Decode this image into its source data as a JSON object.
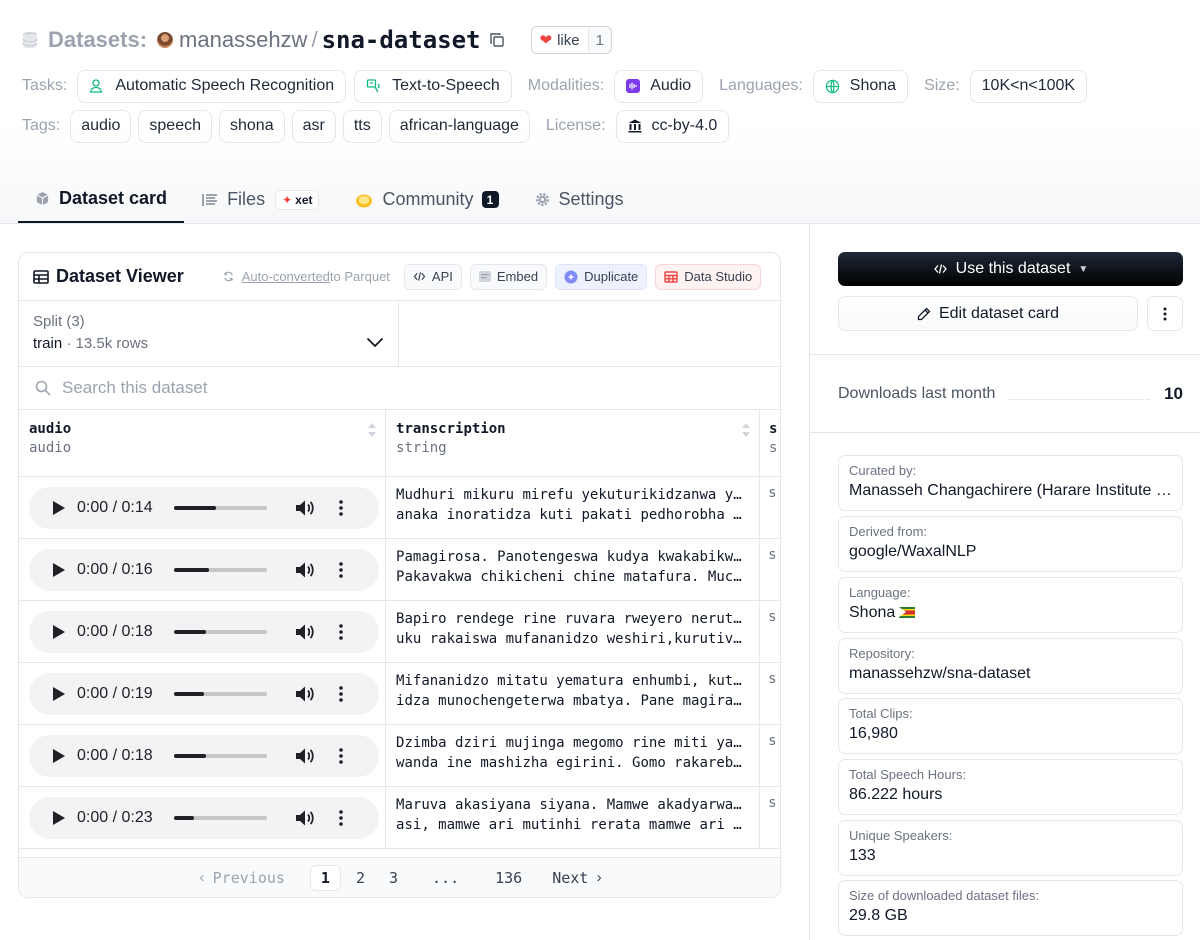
{
  "header": {
    "section": "Datasets:",
    "owner": "manassehzw",
    "separator": "/",
    "repo": "sna-dataset",
    "like_label": "like",
    "like_count": "1"
  },
  "meta": {
    "tasks_label": "Tasks:",
    "tasks": [
      "Automatic Speech Recognition",
      "Text-to-Speech"
    ],
    "modalities_label": "Modalities:",
    "modality": "Audio",
    "languages_label": "Languages:",
    "language": "Shona",
    "size_label": "Size:",
    "size": "10K<n<100K",
    "tags_label": "Tags:",
    "tags": [
      "audio",
      "speech",
      "shona",
      "asr",
      "tts",
      "african-language"
    ],
    "license_label": "License:",
    "license": "cc-by-4.0"
  },
  "tabs": {
    "dataset_card": "Dataset card",
    "files": "Files",
    "xet": "xet",
    "community": "Community",
    "community_count": "1",
    "settings": "Settings"
  },
  "viewer": {
    "title": "Dataset Viewer",
    "auto_converted_link": "Auto-converted",
    "auto_converted_rest": " to Parquet",
    "api": "API",
    "embed": "Embed",
    "duplicate": "Duplicate",
    "data_studio": "Data Studio",
    "split_label": "Split (3)",
    "split_value": "train",
    "split_sep": " · ",
    "split_rows": "13.5k rows",
    "search_placeholder": "Search this dataset",
    "columns": [
      {
        "name": "audio",
        "type": "audio"
      },
      {
        "name": "transcription",
        "type": "string"
      },
      {
        "name": "s",
        "type": "s"
      }
    ],
    "rows": [
      {
        "time": "0:00 / 0:14",
        "progress": 0.45,
        "line1": "Mudhuri mikuru mirefu yekuturikidzanwa yak",
        "line2": "anaka inoratidza kuti pakati pedhorobha s…",
        "ext": "s"
      },
      {
        "time": "0:00 / 0:16",
        "progress": 0.38,
        "line1": "Pamagirosa. Panotengeswa kudya kwakabikwa.",
        "line2": "Pakavakwa chikicheni chine matafura. Much…",
        "ext": "s"
      },
      {
        "time": "0:00 / 0:18",
        "progress": 0.34,
        "line1": "Bapiro rendege rine ruvara rweyero nerutsv",
        "line2": "uku rakaiswa mufananidzo weshiri,kurutivi…",
        "ext": "s"
      },
      {
        "time": "0:00 / 0:19",
        "progress": 0.32,
        "line1": "Mifananidzo mitatu yematura enhumbi, kutar",
        "line2": "idza munochengeterwa mbatya. Pane magiraz…",
        "ext": "s"
      },
      {
        "time": "0:00 / 0:18",
        "progress": 0.34,
        "line1": "Dzimba dziri mujinga megomo rine miti yaka",
        "line2": "wanda ine mashizha egirini. Gomo rakareba…",
        "ext": "s"
      },
      {
        "time": "0:00 / 0:23",
        "progress": 0.21,
        "line1": "Maruva akasiyana siyana. Mamwe akadyarwa p",
        "line2": "asi, mamwe ari mutinhi rerata mamwe ari m…",
        "ext": "s"
      }
    ],
    "pager": {
      "previous": "Previous",
      "pages": [
        "1",
        "2",
        "3",
        "...",
        "136"
      ],
      "next": "Next"
    }
  },
  "sidebar": {
    "use_dataset": "Use this dataset",
    "edit_card": "Edit dataset card",
    "downloads_label": "Downloads last month",
    "downloads_value": "10",
    "cards": [
      {
        "label": "Curated by:",
        "value": "Manasseh Changachirere (Harare Institute of Technology)"
      },
      {
        "label": "Derived from:",
        "value": "google/WaxalNLP"
      },
      {
        "label": "Language:",
        "value": "Shona"
      },
      {
        "label": "Repository:",
        "value": "manassehzw/sna-dataset"
      },
      {
        "label": "Total Clips:",
        "value": "16,980"
      },
      {
        "label": "Total Speech Hours:",
        "value": "86.222 hours"
      },
      {
        "label": "Unique Speakers:",
        "value": "133"
      },
      {
        "label": "Size of downloaded dataset files:",
        "value": "29.8 GB"
      }
    ]
  },
  "colors": {
    "brand_black": "#111827",
    "heart": "#ef4444",
    "task_green": "#10b981",
    "audio_purple": "#7c3aed",
    "duplicate_bg": "#eef2ff",
    "studio_red": "#ef4444"
  },
  "icons": [
    "database-icon",
    "copy-icon",
    "heart-icon",
    "user-voice-icon",
    "speaker-text-icon",
    "audio-icon",
    "globe-icon",
    "bank-icon",
    "cube-icon",
    "files-icon",
    "community-icon",
    "gear-icon",
    "table-icon",
    "refresh-icon",
    "code-icon",
    "embed-icon",
    "duplicate-icon",
    "data-studio-icon",
    "chevron-down-icon",
    "search-icon",
    "sort-icon",
    "play-icon",
    "volume-icon",
    "more-vertical-icon",
    "pencil-icon"
  ]
}
